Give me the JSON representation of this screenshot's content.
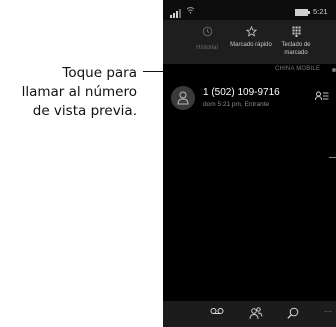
{
  "annotation": {
    "lines": [
      "Toque para",
      "llamar al número",
      "de vista previa."
    ]
  },
  "statusbar": {
    "time": "5:21"
  },
  "tabs": [
    {
      "label": "Historial",
      "icon": "history-icon"
    },
    {
      "label": "Marcado rápido",
      "icon": "star-icon"
    },
    {
      "label": "Teclado de marcado",
      "icon": "dialpad-icon"
    }
  ],
  "carrier": "CHINA MOBILE",
  "call": {
    "number": "1 (502) 109-9716",
    "detail": "dom 5:21 pm, Entrante"
  },
  "appbar": {
    "buttons": [
      "voicemail-icon",
      "contacts-icon",
      "search-icon",
      "more-icon"
    ],
    "more_label": "···"
  },
  "colors": {
    "screen_bg": "#000000",
    "header_bg": "#1e1e1e",
    "appbar_bg": "#1c1c1c",
    "inactive_tab": "#6c6c6c",
    "secondary_text": "#8c8c8c"
  }
}
